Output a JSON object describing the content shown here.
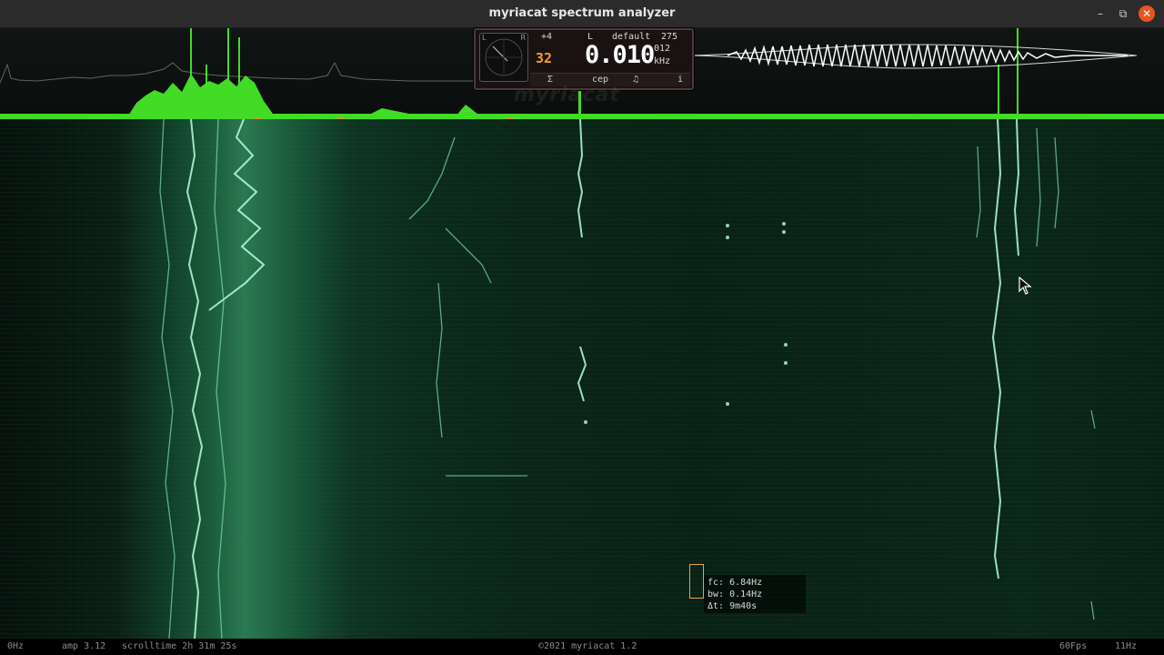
{
  "window": {
    "title": "myriacat spectrum analyzer",
    "controls": {
      "minimize": "–",
      "maximize": "⧉",
      "close": "✕"
    }
  },
  "panel": {
    "scope_left": "L",
    "scope_right": "R",
    "gain": "+4",
    "channel": "L",
    "preset": "default",
    "preset_value": "275",
    "db_readout": "32",
    "freq_digits": "0.010",
    "freq_sub": "012",
    "freq_unit": "kHz",
    "buttons": {
      "sum": "Σ",
      "cep": "cep",
      "note": "♫",
      "info": "i"
    }
  },
  "watermark": "myriacat",
  "infobox": {
    "fc": "fc: 6.84Hz",
    "bw": "bw: 0.14Hz",
    "dt": "Δt: 9m40s"
  },
  "status": {
    "left_freq": "0Hz",
    "amp": "amp 3.12",
    "scrolltime": "scrolltime 2h 31m 25s",
    "copyright": "©2021 myriacat 1.2",
    "fps": "60Fps",
    "right_freq": "11Hz"
  },
  "colors": {
    "accent_orange": "#ff9c2a",
    "spectrum_green": "#4cff2a",
    "waterfall_trace": "#b8ffe0",
    "close_button": "#e95420"
  }
}
